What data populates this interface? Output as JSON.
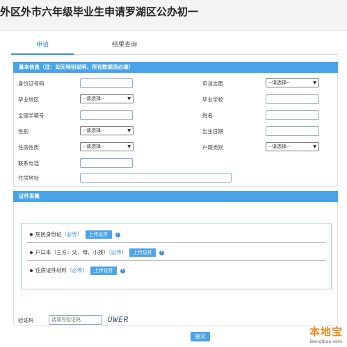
{
  "page_title": "外区外市六年级毕业生申请罗湖区公办初一",
  "tabs": [
    {
      "label": "申请",
      "active": true
    },
    {
      "label": "结果查询",
      "active": false
    }
  ],
  "basic_info": {
    "header": "基本信息（注：如无特别说明，所有数据须必填）",
    "fields": {
      "id_number": "身份证号码",
      "wish": "申请志愿",
      "grad_region": "毕业地区",
      "grad_school": "毕业学校",
      "student_no": "全国学籍号",
      "name": "姓名",
      "gender": "性别",
      "birth_date": "出生日期",
      "housing_type": "住房性质",
      "hukou_type": "户籍类别",
      "phone": "联系电话",
      "address": "住房地址"
    },
    "select_placeholder": "--请选择--"
  },
  "docs": {
    "header": "证件采集",
    "items": [
      {
        "label": "居民身份证",
        "required": "（必传）"
      },
      {
        "label": "户口本（三方：父、母、小孩）",
        "required": "（必传）"
      },
      {
        "label": "住房证件材料",
        "required": "（必传）"
      }
    ],
    "upload_label": "上传证件",
    "info_icon_glyph": "!"
  },
  "captcha": {
    "label": "验证码",
    "placeholder": "请填写验证码",
    "code": "UWER"
  },
  "submit_label": "提交",
  "watermark": {
    "logo": "本地宝",
    "url": "Bendibao.com"
  },
  "colors": {
    "accent": "#4aa3e8",
    "brand": "#f08a1c"
  }
}
